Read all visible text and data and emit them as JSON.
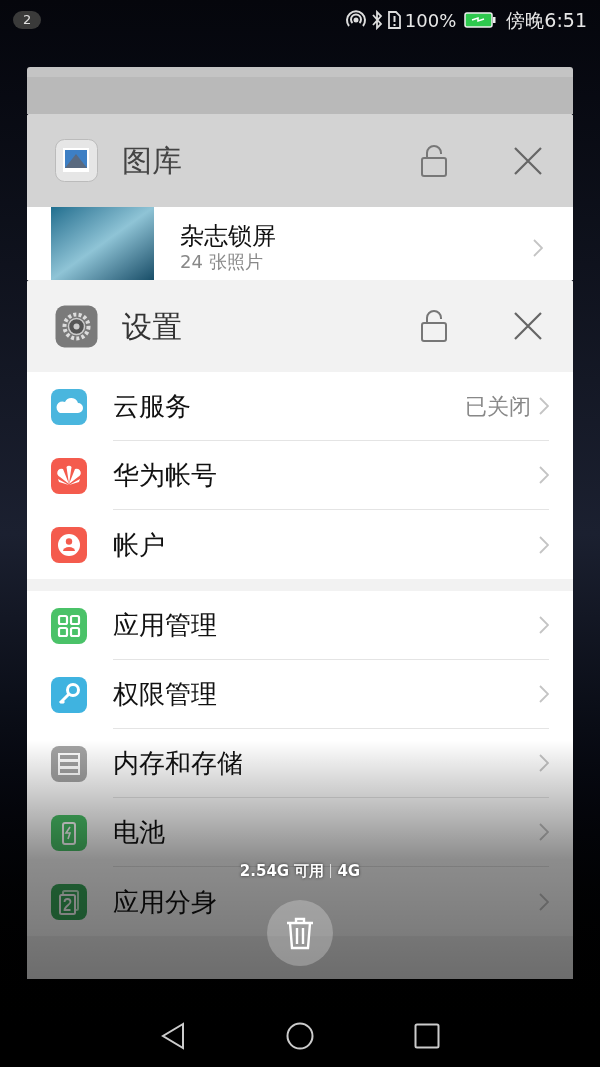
{
  "status_bar": {
    "notification_count": "2",
    "battery": "100%",
    "time": "傍晚6:51"
  },
  "gallery_card": {
    "title": "图库",
    "locked": false,
    "album": {
      "name": "杂志锁屏",
      "count": "24 张照片"
    }
  },
  "settings_card": {
    "title": "设置",
    "locked": false,
    "groups": [
      [
        {
          "kind": "cloud",
          "label": "云服务",
          "value": "已关闭"
        },
        {
          "kind": "huawei",
          "label": "华为帐号"
        },
        {
          "kind": "account",
          "label": "帐户"
        }
      ],
      [
        {
          "kind": "apps",
          "label": "应用管理"
        },
        {
          "kind": "key",
          "label": "权限管理"
        },
        {
          "kind": "storage",
          "label": "内存和存储"
        },
        {
          "kind": "battery",
          "label": "电池"
        },
        {
          "kind": "twin",
          "label": "应用分身"
        }
      ]
    ]
  },
  "memory": {
    "available": "2.54G 可用",
    "total": "4G"
  }
}
